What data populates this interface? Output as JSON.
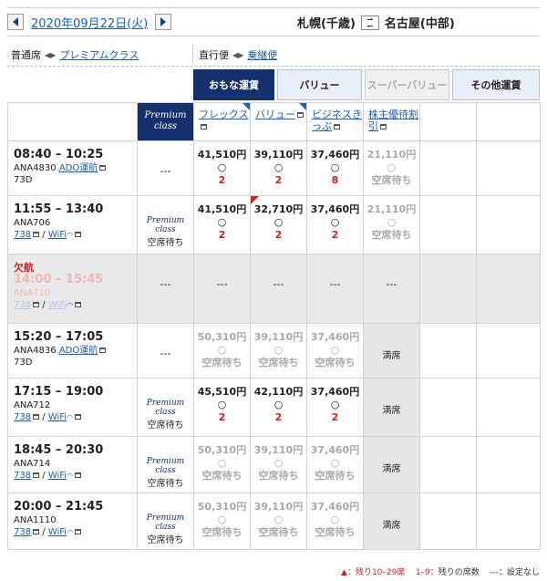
{
  "header": {
    "date": "2020年09月22日(火)",
    "origin": "札幌(千歳)",
    "destination": "名古屋(中部)"
  },
  "options": {
    "cabin_label": "普通席",
    "cabin_alt": "プレミアムクラス",
    "route_label": "直行便",
    "route_alt": "乗継便"
  },
  "tabs": [
    {
      "label": "おもな運賃",
      "state": "active"
    },
    {
      "label": "バリュー",
      "state": "normal"
    },
    {
      "label": "スーパーバリュー",
      "state": "disabled"
    },
    {
      "label": "その他運賃",
      "state": "normal"
    }
  ],
  "columns": {
    "premium": "Premium class",
    "fares": [
      "フレックス",
      "バリュー",
      "ビジネスきっぷ",
      "株主優待割引"
    ]
  },
  "flights": [
    {
      "time": "08:40 – 10:25",
      "code": "ANA4830",
      "operator": "ADO運航",
      "aircraft": "73D",
      "wifi": false,
      "premium": "---",
      "fares": [
        {
          "price": "41,510円",
          "mark": "○",
          "count": "2"
        },
        {
          "price": "39,110円",
          "mark": "○",
          "count": "2"
        },
        {
          "price": "37,460円",
          "mark": "○",
          "count": "8"
        },
        {
          "price": "21,110円",
          "mark": "○",
          "count": "空席待ち",
          "gray": true
        }
      ]
    },
    {
      "time": "11:55 – 13:40",
      "code": "ANA706",
      "aircraft": "738",
      "wifi": true,
      "premium": "空席待ち",
      "fares": [
        {
          "price": "41,510円",
          "mark": "○",
          "count": "2"
        },
        {
          "price": "32,710円",
          "mark": "○",
          "count": "2",
          "flag": true
        },
        {
          "price": "37,460円",
          "mark": "○",
          "count": "2"
        },
        {
          "price": "21,110円",
          "mark": "○",
          "count": "空席待ち",
          "gray": true
        }
      ]
    },
    {
      "time": "14:00 – 15:45",
      "code": "ANA710",
      "aircraft": "738",
      "wifi": true,
      "cancelled": "欠航",
      "premium": "---",
      "fares": [
        {
          "dash": "---"
        },
        {
          "dash": "---"
        },
        {
          "dash": "---"
        },
        {
          "dash": "---"
        }
      ]
    },
    {
      "time": "15:20 – 17:05",
      "code": "ANA4836",
      "operator": "ADO運航",
      "aircraft": "73D",
      "wifi": false,
      "premium": "---",
      "fares": [
        {
          "price": "50,310円",
          "mark": "○",
          "count": "空席待ち",
          "gray": true
        },
        {
          "price": "39,110円",
          "mark": "○",
          "count": "空席待ち",
          "gray": true
        },
        {
          "price": "37,460円",
          "mark": "○",
          "count": "空席待ち",
          "gray": true
        },
        {
          "soldout": "満席"
        }
      ]
    },
    {
      "time": "17:15 – 19:00",
      "code": "ANA712",
      "aircraft": "738",
      "wifi": true,
      "premium": "空席待ち",
      "fares": [
        {
          "price": "45,510円",
          "mark": "○",
          "count": "2"
        },
        {
          "price": "42,110円",
          "mark": "○",
          "count": "2"
        },
        {
          "price": "37,460円",
          "mark": "○",
          "count": "2"
        },
        {
          "soldout": "満席"
        }
      ]
    },
    {
      "time": "18:45 – 20:30",
      "code": "ANA714",
      "aircraft": "738",
      "wifi": true,
      "premium": "空席待ち",
      "fares": [
        {
          "price": "50,310円",
          "mark": "○",
          "count": "空席待ち",
          "gray": true
        },
        {
          "price": "39,110円",
          "mark": "○",
          "count": "空席待ち",
          "gray": true
        },
        {
          "price": "37,460円",
          "mark": "○",
          "count": "空席待ち",
          "gray": true
        },
        {
          "soldout": "満席"
        }
      ]
    },
    {
      "time": "20:00 – 21:45",
      "code": "ANA1110",
      "aircraft": "738",
      "wifi": true,
      "premium": "空席待ち",
      "fares": [
        {
          "price": "50,310円",
          "mark": "○",
          "count": "空席待ち",
          "gray": true
        },
        {
          "price": "39,110円",
          "mark": "○",
          "count": "空席待ち",
          "gray": true
        },
        {
          "price": "37,460円",
          "mark": "○",
          "count": "空席待ち",
          "gray": true
        },
        {
          "soldout": "満席"
        }
      ]
    }
  ],
  "wifi_label": "WiFi",
  "legend": {
    "flag": "▲：残り10–29席",
    "range_key": "1–9",
    "range_text": "：残りの席数",
    "dash_key": "---",
    "dash_text": "：設定なし"
  }
}
